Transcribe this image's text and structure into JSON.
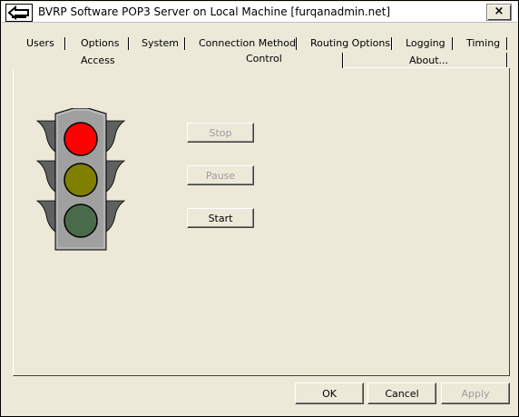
{
  "window": {
    "title": "BVRP Software POP3 Server on Local Machine [furqanadmin.net]",
    "close_label": "×"
  },
  "tabs_back_row": [
    {
      "label": "Users"
    },
    {
      "label": "Options"
    },
    {
      "label": "System"
    },
    {
      "label": "Connection Method"
    },
    {
      "label": "Routing Options"
    },
    {
      "label": "Logging"
    },
    {
      "label": "Timing"
    }
  ],
  "tabs_front_row": [
    {
      "label": "Access"
    },
    {
      "label": "Control"
    },
    {
      "label": "About..."
    }
  ],
  "active_tab": "Control",
  "traffic_light": {
    "active": "red",
    "colors": {
      "red": "#ff0000",
      "yellow": "#808000",
      "green": "#4a6b4a",
      "body": "#a0a0a0"
    }
  },
  "controls": {
    "stop_label": "Stop",
    "pause_label": "Pause",
    "start_label": "Start"
  },
  "footer": {
    "ok_label": "OK",
    "cancel_label": "Cancel",
    "apply_label": "Apply"
  }
}
